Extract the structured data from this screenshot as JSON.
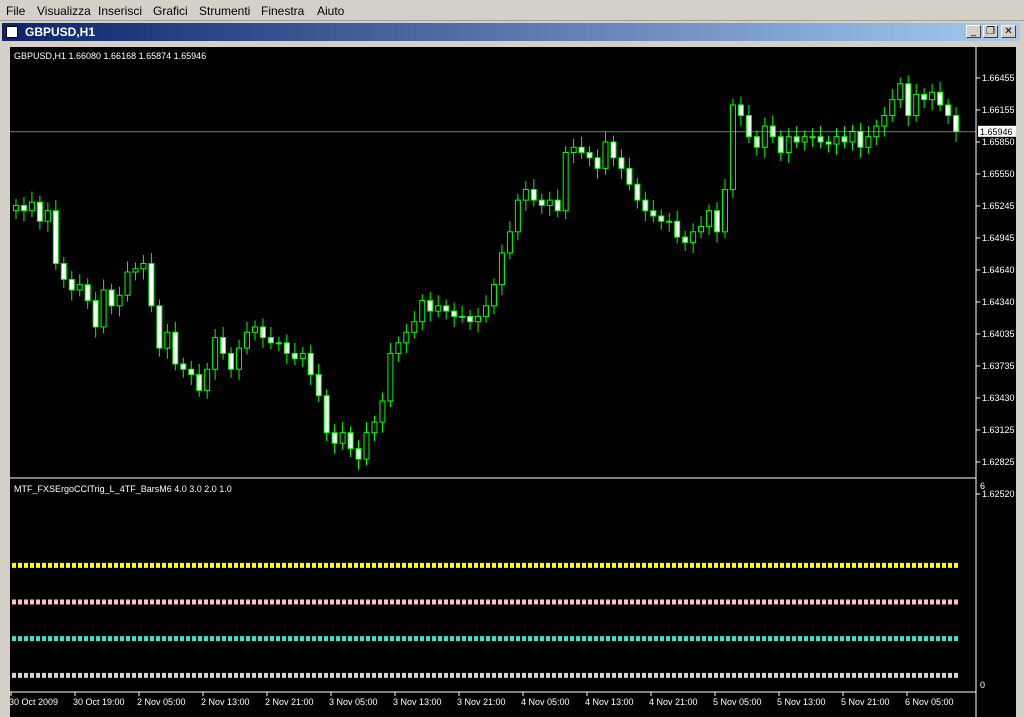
{
  "menu": [
    "File",
    "Visualizza",
    "Inserisci",
    "Grafici",
    "Strumenti",
    "Finestra",
    "Aiuto"
  ],
  "window": {
    "title": "GBPUSD,H1",
    "minimize_glyph": "_",
    "restore_glyph": "❐",
    "close_glyph": "✕"
  },
  "chart": {
    "info_text": "GBPUSD,H1  1.66080 1.66168 1.65874 1.65946",
    "current_price": "1.65946",
    "current_price_value": 1.65946,
    "price_ticks": [
      "1.66455",
      "1.66155",
      "1.65850",
      "1.65550",
      "1.65245",
      "1.64945",
      "1.64640",
      "1.64340",
      "1.64035",
      "1.63735",
      "1.63430",
      "1.63125",
      "1.62825",
      "1.62520"
    ],
    "price_range": [
      1.6252,
      1.66455
    ],
    "time_labels": [
      "30 Oct 2009",
      "30 Oct 19:00",
      "2 Nov 05:00",
      "2 Nov 13:00",
      "2 Nov 21:00",
      "3 Nov 05:00",
      "3 Nov 13:00",
      "3 Nov 21:00",
      "4 Nov 05:00",
      "4 Nov 13:00",
      "4 Nov 21:00",
      "5 Nov 05:00",
      "5 Nov 13:00",
      "5 Nov 21:00",
      "6 Nov 05:00"
    ],
    "candle_color": "#00ff00",
    "bull_fill": "#000000",
    "bear_fill": "#ffffff",
    "bg_color": "#000000",
    "grid_color": "#ffffff",
    "closes": [
      1.6525,
      1.652,
      1.6528,
      1.651,
      1.652,
      1.647,
      1.6455,
      1.6445,
      1.645,
      1.6435,
      1.641,
      1.6445,
      1.643,
      1.644,
      1.6462,
      1.6465,
      1.647,
      1.643,
      1.639,
      1.6405,
      1.6375,
      1.637,
      1.6365,
      1.635,
      1.637,
      1.64,
      1.6385,
      1.637,
      1.639,
      1.6405,
      1.641,
      1.64,
      1.6395,
      1.6395,
      1.6385,
      1.638,
      1.6385,
      1.6365,
      1.6345,
      1.631,
      1.63,
      1.631,
      1.6295,
      1.6285,
      1.631,
      1.632,
      1.634,
      1.6385,
      1.6395,
      1.6405,
      1.6415,
      1.6435,
      1.6425,
      1.643,
      1.6425,
      1.642,
      1.642,
      1.6415,
      1.642,
      1.643,
      1.645,
      1.648,
      1.65,
      1.653,
      1.654,
      1.653,
      1.6525,
      1.653,
      1.652,
      1.6575,
      1.658,
      1.6575,
      1.657,
      1.656,
      1.6585,
      1.657,
      1.656,
      1.6545,
      1.653,
      1.652,
      1.6515,
      1.651,
      1.651,
      1.6495,
      1.649,
      1.65,
      1.6505,
      1.652,
      1.65,
      1.654,
      1.662,
      1.661,
      1.659,
      1.658,
      1.66,
      1.659,
      1.6575,
      1.659,
      1.6585,
      1.659,
      1.659,
      1.6585,
      1.6583,
      1.659,
      1.6585,
      1.6595,
      1.658,
      1.659,
      1.66,
      1.661,
      1.6625,
      1.664,
      1.661,
      1.663,
      1.6625,
      1.6632,
      1.662,
      1.661,
      1.6595
    ]
  },
  "indicator": {
    "label": "MTF_FXSErgoCCITrig_L_4TF_BarsM6 4.0 3.0 2.0 1.0",
    "scale_top": "6",
    "scale_bottom": "0",
    "range": [
      0,
      6
    ],
    "lines": [
      {
        "level": 4,
        "color": "#ffff00"
      },
      {
        "level": 3,
        "color": "#ffc0c0"
      },
      {
        "level": 2,
        "color": "#40e0d0"
      },
      {
        "level": 1,
        "color": "#d3d3d3"
      }
    ]
  }
}
